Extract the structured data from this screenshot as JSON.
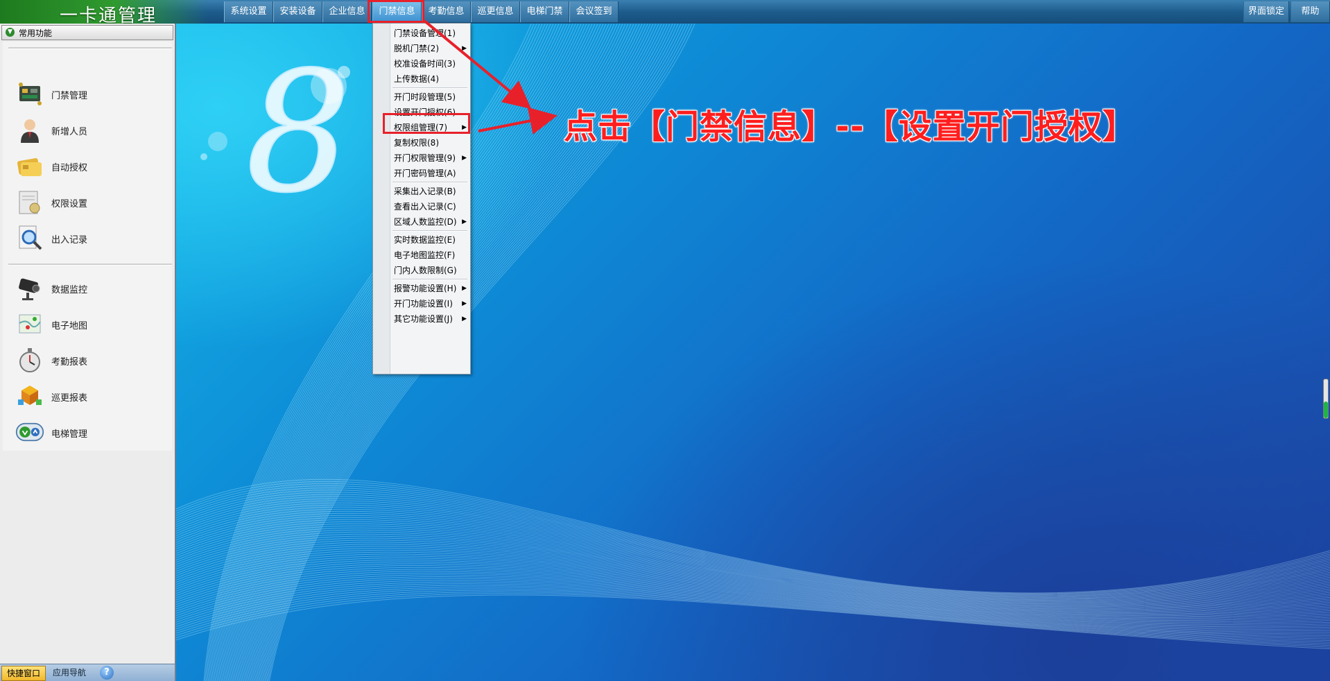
{
  "app": {
    "title": "一卡通管理"
  },
  "menubar": {
    "items": [
      "系统设置",
      "安装设备",
      "企业信息",
      "门禁信息",
      "考勤信息",
      "巡更信息",
      "电梯门禁",
      "会议签到"
    ],
    "active": "门禁信息",
    "right_items": [
      "界面锁定",
      "帮助"
    ]
  },
  "left_panel": {
    "header": "常用功能",
    "group1": [
      {
        "label": "门禁管理",
        "icon": "circuit-board-icon"
      },
      {
        "label": "新增人员",
        "icon": "person-icon"
      },
      {
        "label": "自动授权",
        "icon": "card-icon"
      },
      {
        "label": "权限设置",
        "icon": "certificate-icon"
      },
      {
        "label": "出入记录",
        "icon": "magnifier-document-icon"
      }
    ],
    "group2": [
      {
        "label": "数据监控",
        "icon": "camera-icon"
      },
      {
        "label": "电子地图",
        "icon": "map-icon"
      },
      {
        "label": "考勤报表",
        "icon": "stopwatch-icon"
      },
      {
        "label": "巡更报表",
        "icon": "blocks-icon"
      },
      {
        "label": "电梯管理",
        "icon": "elevator-arrows-icon"
      }
    ],
    "bottom_tabs": {
      "quick": "快捷窗口",
      "nav": "应用导航",
      "help": "?"
    }
  },
  "dropdown": {
    "items": [
      {
        "label": "门禁设备管理(1)",
        "submenu": false
      },
      {
        "label": "脱机门禁(2)",
        "submenu": true
      },
      {
        "label": "校准设备时间(3)",
        "submenu": false
      },
      {
        "label": "上传数据(4)",
        "submenu": false
      },
      {
        "label": "开门时段管理(5)",
        "submenu": false
      },
      {
        "label": "设置开门授权(6)",
        "submenu": false
      },
      {
        "label": "权限组管理(7)",
        "submenu": true
      },
      {
        "label": "复制权限(8)",
        "submenu": false
      },
      {
        "label": "开门权限管理(9)",
        "submenu": true
      },
      {
        "label": "开门密码管理(A)",
        "submenu": false
      },
      {
        "label": "采集出入记录(B)",
        "submenu": false
      },
      {
        "label": "查看出入记录(C)",
        "submenu": false
      },
      {
        "label": "区域人数监控(D)",
        "submenu": true
      },
      {
        "label": "实时数据监控(E)",
        "submenu": false
      },
      {
        "label": "电子地图监控(F)",
        "submenu": false
      },
      {
        "label": "门内人数限制(G)",
        "submenu": false
      },
      {
        "label": "报警功能设置(H)",
        "submenu": true
      },
      {
        "label": "开门功能设置(I)",
        "submenu": true
      },
      {
        "label": "其它功能设置(J)",
        "submenu": true
      }
    ],
    "highlighted": "设置开门授权(6)"
  },
  "annotation": {
    "text": "点击【门禁信息】--【设置开门授权】",
    "color": "#ff1e1e"
  },
  "wallpaper": {
    "emblem": "8"
  },
  "colors": {
    "accent_red": "#e8202a",
    "menubar": "#1d5c8d",
    "logo_green": "#2f9a2f"
  }
}
